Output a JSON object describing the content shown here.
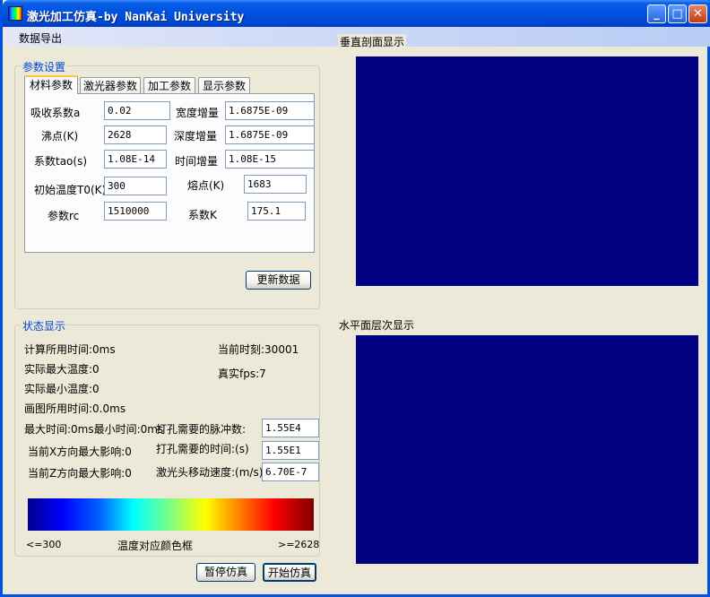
{
  "window": {
    "title": "激光加工仿真-by NanKai University",
    "minimize": "_",
    "maximize": "□",
    "close": "✕"
  },
  "menu": {
    "export": "数据导出"
  },
  "params_group": {
    "legend": "参数设置"
  },
  "tabs": [
    "材料参数",
    "激光器参数",
    "加工参数",
    "显示参数"
  ],
  "material": {
    "absorb_label": "吸收系数a",
    "absorb_value": "0.02",
    "width_inc_label": "宽度增量",
    "width_inc_value": "1.6875E-09",
    "boil_label": "沸点(K)",
    "boil_value": "2628",
    "depth_inc_label": "深度增量",
    "depth_inc_value": "1.6875E-09",
    "tao_label": "系数tao(s)",
    "tao_value": "1.08E-14",
    "time_inc_label": "时间增量",
    "time_inc_value": "1.08E-15",
    "init_temp_label": "初始温度T0(K)",
    "init_temp_value": "300",
    "melt_label": "熔点(K)",
    "melt_value": "1683",
    "rc_label": "参数rc",
    "rc_value": "1510000",
    "k_label": "系数K",
    "k_value": "175.1"
  },
  "update_button": "更新数据",
  "status_group": {
    "legend": "状态显示",
    "calc_time": "计算所用时间:0ms",
    "current_moment": "当前时刻:30001",
    "max_temp": "实际最大温度:0",
    "fps": "真实fps:7",
    "min_temp": "实际最小温度:0",
    "draw_time": "画图所用时间:0.0ms",
    "max_min_time": "最大时间:0ms最小时间:0ms",
    "pulses_label": "打孔需要的脉冲数:",
    "pulses_value": "1.55E4",
    "x_influence": "当前X方向最大影响:0",
    "drill_time_label": "打孔需要的时间:(s)",
    "drill_time_value": "1.55E1",
    "z_influence": "当前Z方向最大影响:0",
    "speed_label": "激光头移动速度:(m/s)",
    "speed_value": "6.70E-7",
    "scale_min": "<=300",
    "scale_title": "温度对应颜色框",
    "scale_max": ">=2628"
  },
  "buttons": {
    "pause": "暂停仿真",
    "start": "开始仿真"
  },
  "views": {
    "vertical_title": "垂直剖面显示",
    "horizontal_title": "水平面层次显示",
    "fill_color": "#000080"
  },
  "colorbar": {
    "stops": [
      "#00008F",
      "#0000FF",
      "#00FFFF",
      "#FFFF00",
      "#FF0000",
      "#800000"
    ]
  }
}
